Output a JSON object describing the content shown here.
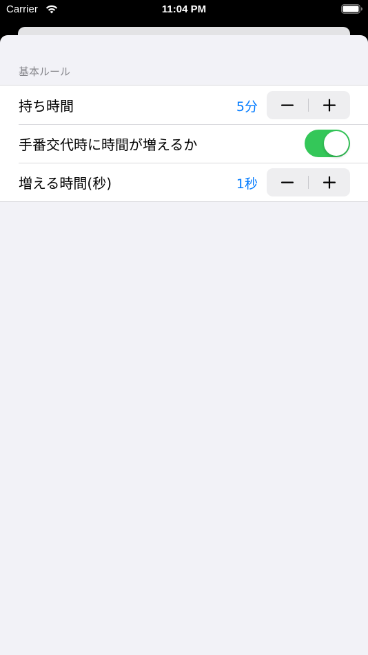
{
  "status_bar": {
    "carrier": "Carrier",
    "time": "11:04 PM"
  },
  "section": {
    "header": "基本ルール"
  },
  "rows": [
    {
      "label": "持ち時間",
      "value": "5分",
      "control": "stepper"
    },
    {
      "label": "手番交代時に時間が増えるか",
      "control": "toggle",
      "toggle_on": true
    },
    {
      "label": "増える時間(秒)",
      "value": "1秒",
      "control": "stepper"
    }
  ],
  "colors": {
    "accent": "#007aff",
    "toggle_on": "#34c759",
    "background": "#f2f2f7",
    "section_header": "#86868b"
  },
  "icons": {
    "wifi": "wifi-icon",
    "battery": "battery-icon",
    "minus": "minus-icon",
    "plus": "plus-icon"
  }
}
